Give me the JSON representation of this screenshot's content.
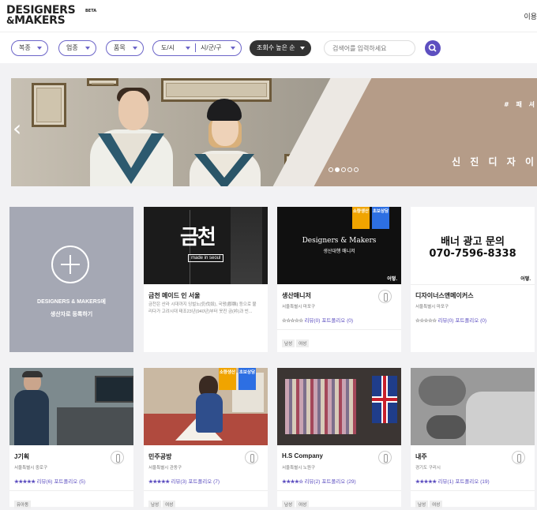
{
  "header": {
    "logo_line1": "DESIGNERS",
    "logo_line2": "MAKERS",
    "logo_beta": "BETA",
    "right_text": "이용"
  },
  "filters": {
    "pill1": "복종",
    "pill2": "업종",
    "pill3": "품목",
    "region_a": "도/시",
    "region_b": "시/군/구",
    "sort": "조회수 높은 순",
    "search_placeholder": "검색어를 입력하세요"
  },
  "banner": {
    "tag": "# 패 셔",
    "title": "신 진 디 자 이",
    "prev": "‹",
    "page_dots": 5,
    "active_dot": 2
  },
  "register": {
    "line1": "DESIGNERS & MAKERS에",
    "line2": "생산자로 등록하기"
  },
  "cards_row1": [
    {
      "name": "금천 메이드 인 서울",
      "desc": "금천은 산라 시대까지 잉벌노(仍伐奴), 국왕(郡縣) 등으로 불리다가 고려시대 태조23년(940년)부터 옷진 금(衿)과 빈...",
      "image_text_top": "금천",
      "image_text_bottom": "made in seoul"
    },
    {
      "name": "생산매니저",
      "loc": "서울특별시 마포구",
      "stars": "☆☆☆☆☆",
      "reviews": "리뷰(0)",
      "portfolio": "포트폴리오 (0)",
      "tags": [
        "남성",
        "여성"
      ],
      "badge_a": "소량생산",
      "badge_b": "초보상담",
      "image_text_top": "Designers & Makers",
      "image_text_bottom": "생산대행 매니저",
      "mark": "어떻."
    },
    {
      "name": "디자이너스앤메이커스",
      "loc": "서울특별시 마포구",
      "stars": "☆☆☆☆☆",
      "reviews": "리뷰(0)",
      "portfolio": "포트폴리오 (0)",
      "ad_line1": "배너 광고 문의",
      "ad_line2": "070-7596-8338",
      "mark": "어떻."
    }
  ],
  "cards_row2": [
    {
      "name": "J기획",
      "loc": "서울특별시 중로구",
      "stars": "★★★★★",
      "reviews": "리뷰(6)",
      "portfolio": "포트폴리오 (5)",
      "tags": [
        "유아동"
      ]
    },
    {
      "name": "민주공방",
      "loc": "서울특별시 관동구",
      "stars": "★★★★★",
      "reviews": "리뷰(3)",
      "portfolio": "포트폴리오 (7)",
      "tags": [
        "남성",
        "여성"
      ],
      "badge_a": "소량생산",
      "badge_b": "초보상담"
    },
    {
      "name": "H.S Company",
      "loc": "서울특별시 노원구",
      "stars": "★★★★☆",
      "reviews": "리뷰(2)",
      "portfolio": "포트폴리오 (29)",
      "tags": [
        "남성",
        "여성"
      ]
    },
    {
      "name": "내주",
      "loc": "경기도 구리시",
      "stars": "★★★★★",
      "reviews": "리뷰(1)",
      "portfolio": "포트폴리오 (19)",
      "tags": [
        "남성",
        "여성"
      ]
    }
  ],
  "colors": {
    "accent": "#5d4fc0",
    "pill_border": "#6b64c8",
    "badge_yellow": "#f0a400",
    "badge_blue": "#2d6fe3"
  }
}
